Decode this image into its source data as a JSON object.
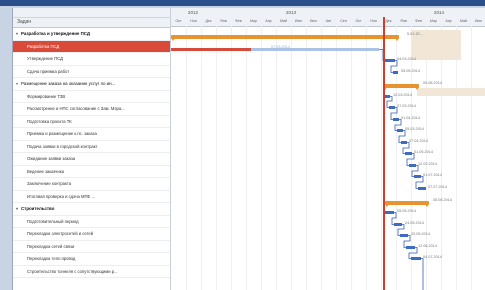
{
  "columns": {
    "task_header": "Задач"
  },
  "timescale": {
    "years": [
      "2012",
      "2013",
      "2014"
    ],
    "months": [
      "Окт",
      "Ноя",
      "Дек",
      "Янв",
      "Фев",
      "Мар",
      "Апр",
      "Май",
      "Июн",
      "Июл",
      "Авг",
      "Сен",
      "Окт",
      "Ноя",
      "Дек",
      "Янв",
      "Фев",
      "Мар",
      "Апр",
      "Май",
      "Июн"
    ]
  },
  "tasks": [
    {
      "label": "Разработка и утверждение ПСД",
      "type": "group",
      "toggle": "▾"
    },
    {
      "label": "Разработка ПСД",
      "type": "child",
      "selected": true
    },
    {
      "label": "Утверждение ПСД",
      "type": "child"
    },
    {
      "label": "Сдача приемка работ",
      "type": "child"
    },
    {
      "label": "Размещение заказа на оказание услуг по ин...",
      "type": "group",
      "toggle": "▾"
    },
    {
      "label": "Формирование ТЗВ",
      "type": "child"
    },
    {
      "label": "Рассмотрение и НПС согласование с Зам. Мэра...",
      "type": "child"
    },
    {
      "label": "Подготовка проекта ТК",
      "type": "child"
    },
    {
      "label": "Приемка и размещение к.пс. заказа",
      "type": "child"
    },
    {
      "label": "Подача заявки в городской контракт",
      "type": "child"
    },
    {
      "label": "Ожидание заявки заказа",
      "type": "child"
    },
    {
      "label": "Ведение заказчика",
      "type": "child"
    },
    {
      "label": "Заключение контракта",
      "type": "child"
    },
    {
      "label": "Итоговая проверка и сдача МПЕ ...",
      "type": "child"
    },
    {
      "label": "Строительство",
      "type": "group",
      "toggle": "▾"
    },
    {
      "label": "Подготовительный период",
      "type": "child"
    },
    {
      "label": "Перекладка электросетей и сетей",
      "type": "child"
    },
    {
      "label": "Перекладка сетей связи",
      "type": "child"
    },
    {
      "label": "Перекладка тепл.провод",
      "type": "child"
    },
    {
      "label": "Строительство тоннеля с сопутствующими р...",
      "type": "child"
    }
  ],
  "bar_labels": [
    "5.01.20...",
    "07.03.2014",
    "04.03.2014",
    "05.05.2014",
    "09.08.2014",
    "12.03.2014",
    "07.03.2014",
    "01.04.2014",
    "05.03.2014",
    "07.04.2014",
    "01.05.2014",
    "12.03.2014",
    "01.07.2014",
    "07.07.2014",
    "05.08.2014",
    "05.05.2014",
    "24.05.2014",
    "20.05.2014",
    "12.08.2014",
    "04.07.2014"
  ],
  "colors": {
    "today_line": "#d83a2a",
    "summary_bar": "#e7932e",
    "task_bar": "#3d6cc0",
    "selected_row": "#d94a38"
  }
}
